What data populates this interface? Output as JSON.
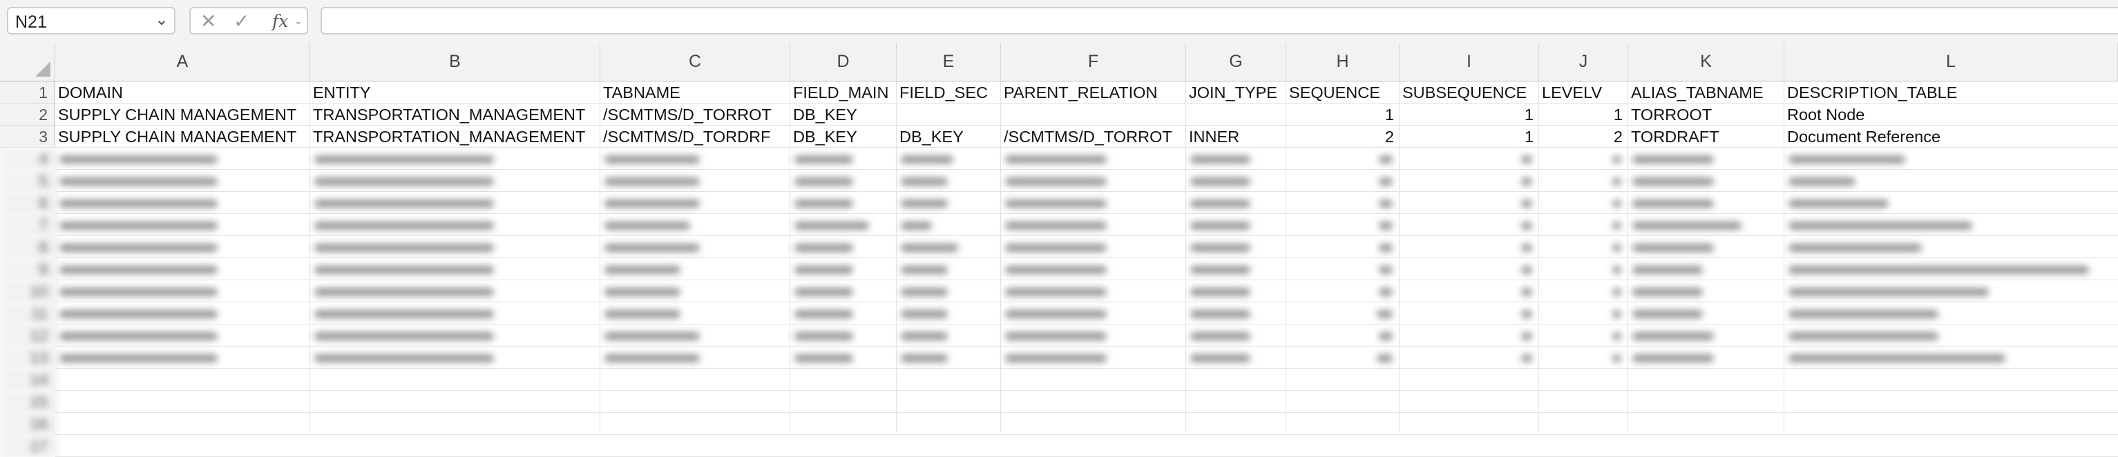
{
  "formula_bar": {
    "name_box": "N21",
    "cancel_icon": "close-icon",
    "confirm_icon": "check-icon",
    "fx_label": "fx",
    "formula_value": ""
  },
  "columns": [
    "A",
    "B",
    "C",
    "D",
    "E",
    "F",
    "G",
    "H",
    "I",
    "J",
    "K",
    "L"
  ],
  "row_numbers": [
    "1",
    "2",
    "3",
    "4",
    "5",
    "6",
    "7",
    "8",
    "9",
    "10",
    "11",
    "12",
    "13",
    "14",
    "15",
    "16",
    "17"
  ],
  "header_row": {
    "A": "DOMAIN",
    "B": "ENTITY",
    "C": "TABNAME",
    "D": "FIELD_MAIN",
    "E": "FIELD_SEC",
    "F": "PARENT_RELATION",
    "G": "JOIN_TYPE",
    "H": "SEQUENCE",
    "I": "SUBSEQUENCE",
    "J": "LEVELV",
    "K": "ALIAS_TABNAME",
    "L": "DESCRIPTION_TABLE"
  },
  "rows": [
    {
      "A": "SUPPLY CHAIN MANAGEMENT",
      "B": "TRANSPORTATION_MANAGEMENT",
      "C": "/SCMTMS/D_TORROT",
      "D": "DB_KEY",
      "E": "",
      "F": "",
      "G": "",
      "H": "1",
      "I": "1",
      "J": "1",
      "K": "TORROOT",
      "L": "Root Node"
    },
    {
      "A": "SUPPLY CHAIN MANAGEMENT",
      "B": "TRANSPORTATION_MANAGEMENT",
      "C": "/SCMTMS/D_TORDRF",
      "D": "DB_KEY",
      "E": "DB_KEY",
      "F": "/SCMTMS/D_TORROT",
      "G": "INNER",
      "H": "2",
      "I": "1",
      "J": "2",
      "K": "TORDRAFT",
      "L": "Document Reference"
    }
  ]
}
